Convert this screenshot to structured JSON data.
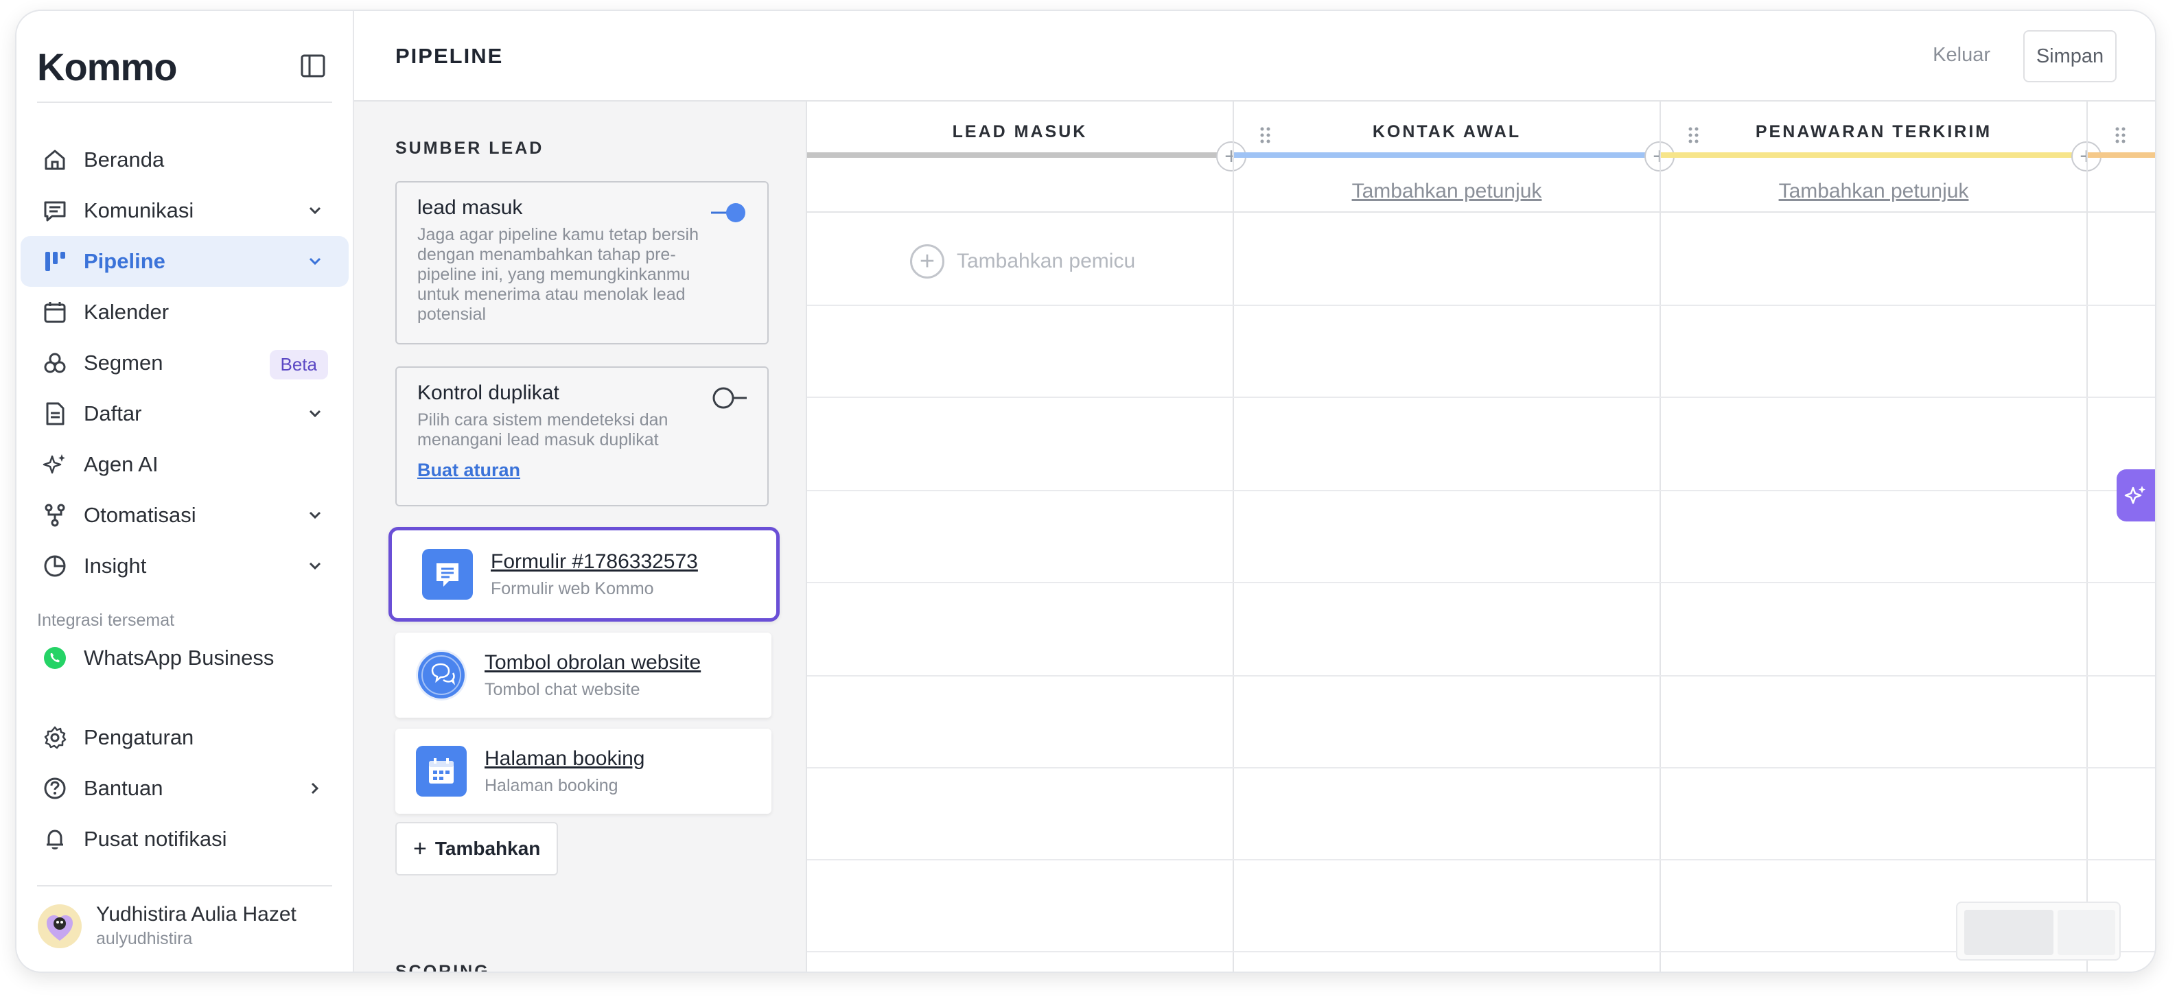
{
  "app": {
    "logo_text": "Kommo"
  },
  "sidebar": {
    "items": [
      {
        "label": "Beranda",
        "icon": "home-icon"
      },
      {
        "label": "Komunikasi",
        "icon": "chat-icon",
        "has_chevron": true
      },
      {
        "label": "Pipeline",
        "icon": "pipeline-icon",
        "has_chevron": true,
        "active": true
      },
      {
        "label": "Kalender",
        "icon": "calendar-icon"
      },
      {
        "label": "Segmen",
        "icon": "segments-icon",
        "badge": "Beta"
      },
      {
        "label": "Daftar",
        "icon": "list-icon",
        "has_chevron": true
      },
      {
        "label": "Agen AI",
        "icon": "sparkle-icon"
      },
      {
        "label": "Otomatisasi",
        "icon": "automation-icon",
        "has_chevron": true
      },
      {
        "label": "Insight",
        "icon": "pie-chart-icon",
        "has_chevron": true
      }
    ],
    "integrations_label": "Integrasi tersemat",
    "integrations": [
      {
        "label": "WhatsApp Business",
        "icon": "whatsapp-icon"
      }
    ],
    "bottom_items": [
      {
        "label": "Pengaturan",
        "icon": "gear-icon"
      },
      {
        "label": "Bantuan",
        "icon": "help-icon",
        "has_arrow": true
      },
      {
        "label": "Pusat notifikasi",
        "icon": "bell-icon"
      }
    ],
    "profile": {
      "name": "Yudhistira Aulia Hazet",
      "username": "aulyudhistira"
    }
  },
  "panel": {
    "title": "PIPELINE",
    "section_title": "SUMBER LEAD",
    "lead_card": {
      "title": "lead masuk",
      "description": "Jaga agar pipeline kamu tetap bersih dengan menambahkan tahap pre-pipeline ini, yang memungkinkanmu untuk menerima atau menolak lead potensial",
      "toggle_on": true
    },
    "duplicate_card": {
      "title": "Kontrol duplikat",
      "description": "Pilih cara sistem mendeteksi dan menangani lead masuk duplikat",
      "link": "Buat aturan",
      "toggle_on": false
    },
    "sources": [
      {
        "title": "Formulir #1786332573",
        "subtitle": "Formulir web Kommo",
        "icon": "form-icon",
        "selected": true
      },
      {
        "title": "Tombol obrolan website",
        "subtitle": "Tombol chat website",
        "icon": "chat-bubbles-icon"
      },
      {
        "title": "Halaman booking",
        "subtitle": "Halaman booking",
        "icon": "calendar-booking-icon"
      }
    ],
    "add_label": "Tambahkan",
    "scoring_label": "SCORING"
  },
  "board": {
    "exit_label": "Keluar",
    "save_label": "Simpan",
    "columns": [
      {
        "title": "LEAD MASUK",
        "color": "#c4c4c4",
        "hint": ""
      },
      {
        "title": "KONTAK AWAL",
        "color": "#9fc3f5",
        "hint": "Tambahkan petunjuk"
      },
      {
        "title": "PENAWARAN TERKIRIM",
        "color": "#f7e58a",
        "hint": "Tambahkan petunjuk"
      }
    ],
    "trigger_label": "Tambahkan pemicu"
  },
  "colors": {
    "accent": "#3b73d9",
    "selection": "#6a4fd6",
    "ai_button": "#8a6cf0",
    "whatsapp": "#25d366"
  }
}
